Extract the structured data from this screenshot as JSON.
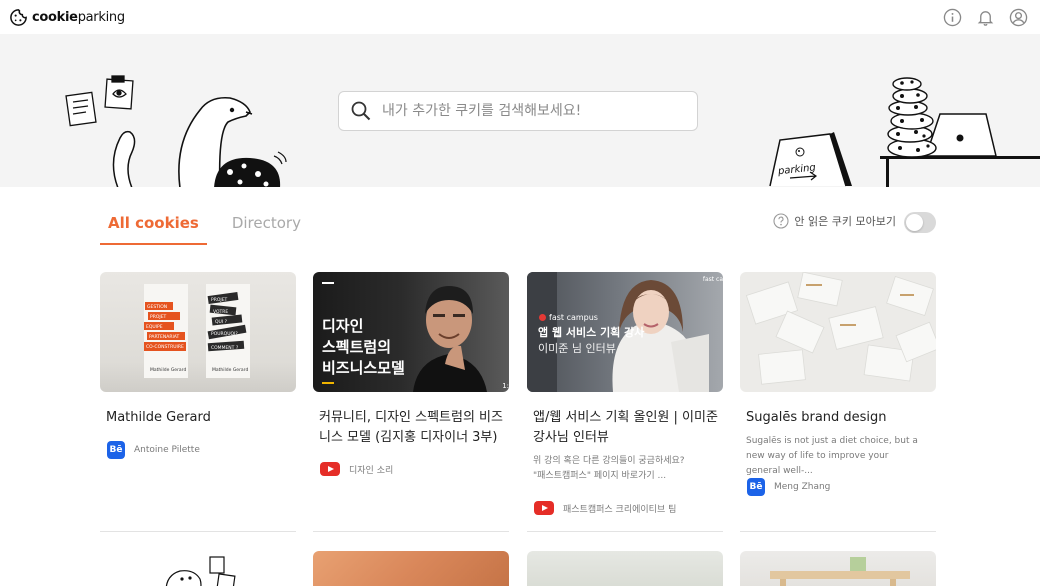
{
  "app": {
    "logo_bold": "cookie",
    "logo_rest": "parking"
  },
  "search": {
    "placeholder": "내가 추가한 쿠키를 검색해보세요!"
  },
  "hero": {
    "parking_sign": "parking"
  },
  "tabs": [
    {
      "label": "All cookies",
      "active": true
    },
    {
      "label": "Directory",
      "active": false
    }
  ],
  "filter": {
    "unread_label": "안 읽은 쿠키 모아보기",
    "unread_enabled": false
  },
  "colors": {
    "accent": "#ee6a35",
    "behance": "#1c63e8",
    "youtube": "#e52d27"
  },
  "cards": [
    {
      "title": "Mathilde Gerard",
      "description": "",
      "source_name": "Antoine Pilette",
      "source_icon": "behance-icon",
      "thumb": {
        "left_tags": [
          "GESTION",
          "PROJET",
          "EQUIPE",
          "PARTENARIAT",
          "CO-CONSTRUIRE"
        ],
        "right_tags": [
          "PROJET",
          "VOTRE",
          "QUI ?",
          "POURQUOI?",
          "COMMENT ?"
        ],
        "caption": "Mathilde Gerard"
      }
    },
    {
      "title": "커뮤니티, 디자인 스펙트럼의 비즈니스 모델 (김지홍 디자이너 3부)",
      "description": "",
      "source_name": "디자인 소리",
      "source_icon": "youtube-icon",
      "thumb": {
        "overlay_text": "디자인\n스펙트럼의\n비즈니스모델",
        "corner": "1:"
      }
    },
    {
      "title": "앱/웹 서비스 기획 올인원 | 이미준 강사님 인터뷰",
      "description": "위 강의 혹은 다른 강의들이 궁금하세요? \"패스트캠퍼스\" 페이지 바로가기 ...",
      "source_name": "패스트캠퍼스 크리에이티브 팀",
      "source_icon": "youtube-icon",
      "thumb": {
        "brand": "fast campus",
        "line1": "앱 웹 서비스 기획 강사",
        "line2": "이미준 님 인터뷰",
        "corner_brand": "fast ca"
      }
    },
    {
      "title": "Sugalēs brand design",
      "description": "Sugalēs is not just a diet choice, but a new way of life to improve your general well-...",
      "source_name": "Meng Zhang",
      "source_icon": "behance-icon",
      "thumb": {}
    }
  ]
}
